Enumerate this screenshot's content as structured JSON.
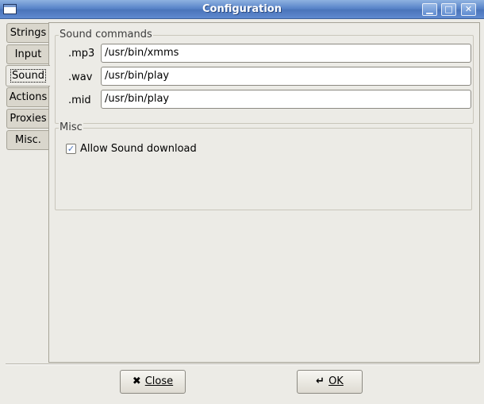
{
  "window": {
    "title": "Configuration",
    "controls": {
      "minimize": "▁",
      "maximize": "□",
      "close": "✕"
    }
  },
  "tabs": [
    {
      "label": "Strings"
    },
    {
      "label": "Input"
    },
    {
      "label": "Sound",
      "active": true
    },
    {
      "label": "Actions"
    },
    {
      "label": "Proxies"
    },
    {
      "label": "Misc."
    }
  ],
  "sound_commands": {
    "label": "Sound commands",
    "rows": [
      {
        "ext": ".mp3",
        "value": "/usr/bin/xmms"
      },
      {
        "ext": ".wav",
        "value": "/usr/bin/play"
      },
      {
        "ext": ".mid",
        "value": "/usr/bin/play"
      }
    ]
  },
  "misc": {
    "label": "Misc",
    "allow_sound_download": {
      "label": "Allow Sound download",
      "checked": true,
      "mark": "✓"
    }
  },
  "buttons": {
    "close": {
      "icon": "✖",
      "label": "Close"
    },
    "ok": {
      "icon": "↵",
      "label": "OK"
    }
  }
}
